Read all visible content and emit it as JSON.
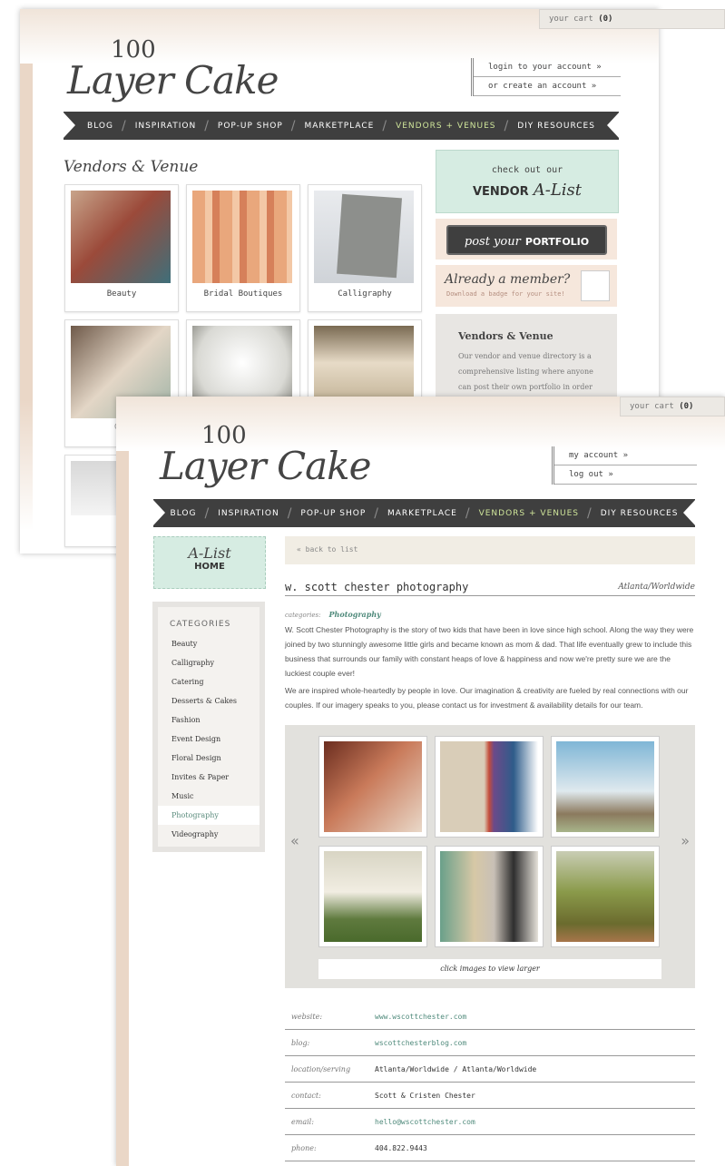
{
  "back": {
    "cart_label": "your cart",
    "cart_count": "(0)",
    "logo_number": "100",
    "logo_script": "Layer Cake",
    "account": [
      "login to your account »",
      "or create an account »"
    ],
    "nav": [
      "BLOG",
      "INSPIRATION",
      "POP-UP SHOP",
      "MARKETPLACE",
      "VENDORS + VENUES",
      "DIY RESOURCES"
    ],
    "nav_active_index": 4,
    "page_title": "Vendors & Venue",
    "tiles": [
      "Beauty",
      "Bridal Boutiques",
      "Calligraphy",
      "Cat"
    ],
    "promo_check_out": "check out our",
    "promo_vendor": "VENDOR",
    "promo_alist": "A-List",
    "promo_post_script": "post your",
    "promo_post_bold": "PORTFOLIO",
    "promo_member": "Already a member?",
    "promo_member_sub": "Download a badge for your site!",
    "about_title": "Vendors & Venue",
    "about_text": "Our vendor and venue directory is a comprehensive listing where anyone can post their own portfolio in order to"
  },
  "front": {
    "cart_label": "your cart",
    "cart_count": "(0)",
    "logo_number": "100",
    "logo_script": "Layer Cake",
    "account": [
      "my account »",
      "log out »"
    ],
    "nav": [
      "BLOG",
      "INSPIRATION",
      "POP-UP SHOP",
      "MARKETPLACE",
      "VENDORS + VENUES",
      "DIY RESOURCES"
    ],
    "nav_active_index": 4,
    "alist_script": "A-List",
    "alist_home": "HOME",
    "categories_title": "CATEGORIES",
    "categories": [
      "Beauty",
      "Calligraphy",
      "Catering",
      "Desserts & Cakes",
      "Fashion",
      "Event Design",
      "Floral Design",
      "Invites & Paper",
      "Music",
      "Photography",
      "Videography"
    ],
    "selected_category": "Photography",
    "back_to_list": "« back to list",
    "vendor_name": "w. scott chester photography",
    "vendor_location": "Atlanta/Worldwide",
    "categories_label": "categories:",
    "categories_value": "Photography",
    "para1": "W. Scott Chester Photography is the story of two kids that have been in love since high school. Along the way they were joined by two stunningly awesome little girls and became known as mom & dad. That life eventually grew to include this business that surrounds our family with constant heaps of love & happiness and now we're pretty sure we are the luckiest couple ever!",
    "para2": "We are inspired whole-heartedly by people in love. Our imagination & creativity are fueled by real connections with our couples. If our imagery speaks to you, please contact us for investment & availability details for our team.",
    "gallery_prev": "«",
    "gallery_next": "»",
    "gallery_note": "click images to view larger",
    "info": [
      {
        "label": "website:",
        "value": "www.wscottchester.com",
        "link": true
      },
      {
        "label": "blog:",
        "value": "wscottchesterblog.com",
        "link": true
      },
      {
        "label": "location/serving",
        "value": "Atlanta/Worldwide / Atlanta/Worldwide",
        "link": false
      },
      {
        "label": "contact:",
        "value": "Scott & Cristen Chester",
        "link": false
      },
      {
        "label": "email:",
        "value": "hello@wscottchester.com",
        "link": true
      },
      {
        "label": "phone:",
        "value": "404.822.9443",
        "link": false
      }
    ]
  }
}
